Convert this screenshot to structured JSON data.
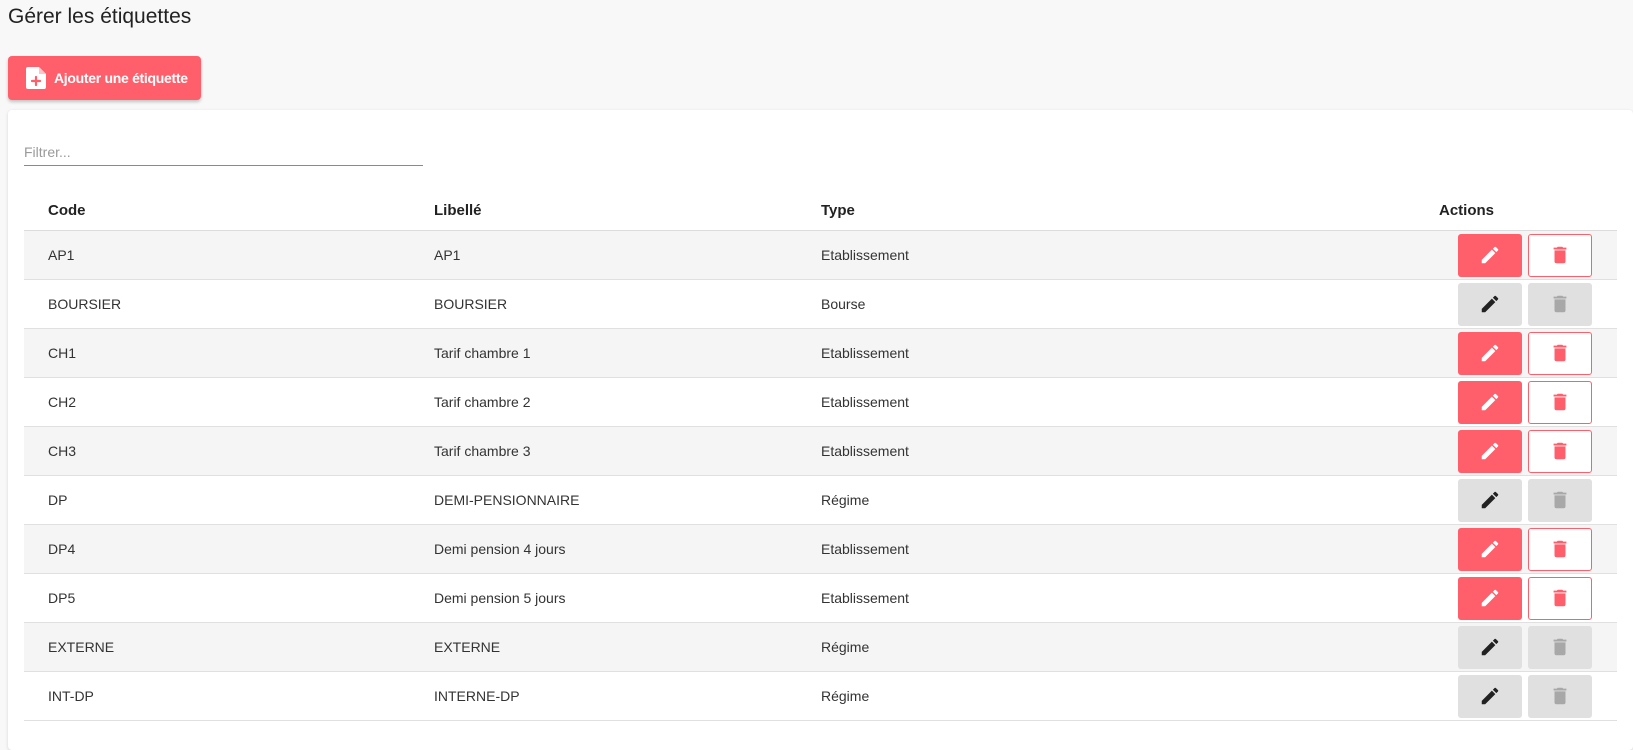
{
  "page": {
    "title": "Gérer les étiquettes"
  },
  "toolbar": {
    "add_label": "Ajouter une étiquette"
  },
  "filter": {
    "placeholder": "Filtrer...",
    "value": ""
  },
  "table": {
    "columns": {
      "code": "Code",
      "libelle": "Libellé",
      "type": "Type",
      "actions": "Actions"
    },
    "rows": [
      {
        "code": "AP1",
        "libelle": "AP1",
        "type": "Etablissement",
        "actions_enabled": true
      },
      {
        "code": "BOURSIER",
        "libelle": "BOURSIER",
        "type": "Bourse",
        "actions_enabled": false
      },
      {
        "code": "CH1",
        "libelle": "Tarif chambre 1",
        "type": "Etablissement",
        "actions_enabled": true
      },
      {
        "code": "CH2",
        "libelle": "Tarif chambre 2",
        "type": "Etablissement",
        "actions_enabled": true
      },
      {
        "code": "CH3",
        "libelle": "Tarif chambre 3",
        "type": "Etablissement",
        "actions_enabled": true
      },
      {
        "code": "DP",
        "libelle": "DEMI-PENSIONNAIRE",
        "type": "Régime",
        "actions_enabled": false
      },
      {
        "code": "DP4",
        "libelle": "Demi pension 4 jours",
        "type": "Etablissement",
        "actions_enabled": true
      },
      {
        "code": "DP5",
        "libelle": "Demi pension 5 jours",
        "type": "Etablissement",
        "actions_enabled": true
      },
      {
        "code": "EXTERNE",
        "libelle": "EXTERNE",
        "type": "Régime",
        "actions_enabled": false
      },
      {
        "code": "INT-DP",
        "libelle": "INTERNE-DP",
        "type": "Régime",
        "actions_enabled": false
      }
    ]
  },
  "icons": {
    "add": "file-plus-icon",
    "edit": "pencil-icon",
    "delete": "trash-icon"
  },
  "colors": {
    "accent": "#ff5f6b",
    "disabled_bg": "#e0e0e0",
    "disabled_icon_edit": "#222222",
    "disabled_icon_delete": "#a8a8a8"
  }
}
